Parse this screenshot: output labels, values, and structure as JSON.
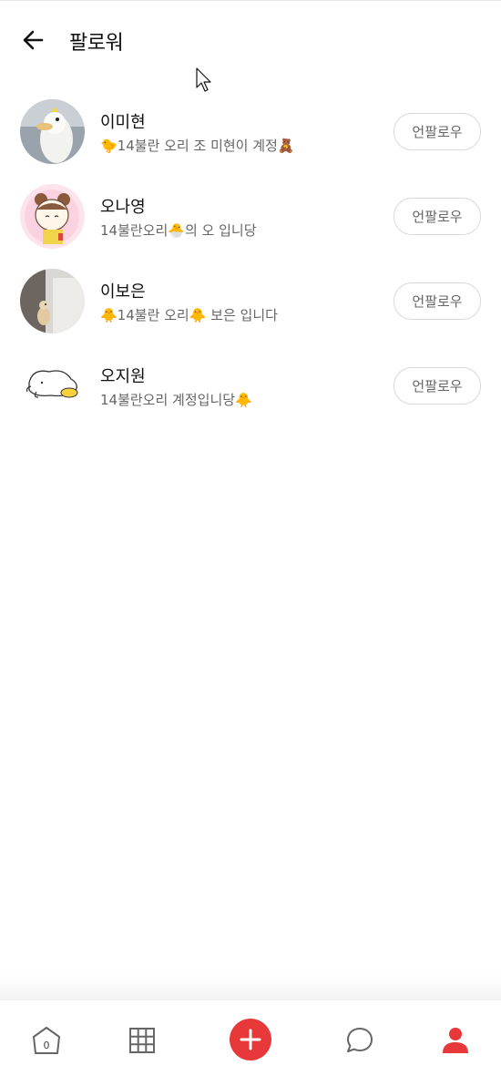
{
  "header": {
    "title": "팔로워",
    "back_icon": "arrow-left-icon"
  },
  "followers": [
    {
      "name": "이미현",
      "bio": "🐤14불란 오리 조 미현이 계정🧸",
      "button": "언팔로우"
    },
    {
      "name": "오나영",
      "bio": "14불란오리🐣의 오 입니당",
      "button": "언팔로우"
    },
    {
      "name": "이보은",
      "bio": "🐥14불란 오리🐥 보은 입니다",
      "button": "언팔로우"
    },
    {
      "name": "오지원",
      "bio": "14불란오리 계정입니당🐥",
      "button": "언팔로우"
    }
  ],
  "nav": {
    "home_badge": "0",
    "items": [
      "home-icon",
      "grid-icon",
      "plus-icon",
      "chat-icon",
      "user-icon"
    ]
  },
  "colors": {
    "accent": "#e8393a",
    "text_secondary": "#666666",
    "border": "#d9d9d9"
  }
}
